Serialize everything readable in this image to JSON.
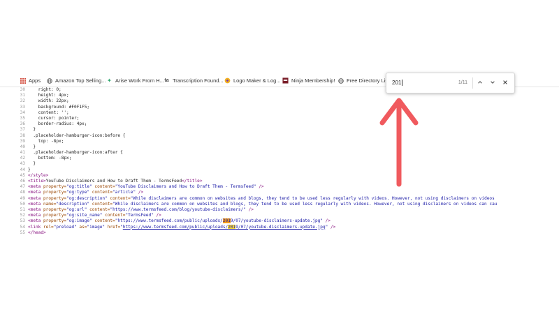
{
  "bookmarks": [
    {
      "label": "Apps",
      "icon": "apps-grid-icon"
    },
    {
      "label": "Amazon Top Selling...",
      "icon": "globe-icon"
    },
    {
      "label": "Arise Work From H...",
      "icon": "star-icon"
    },
    {
      "label": "Transcription Found...",
      "icon": "ta-icon"
    },
    {
      "label": "Logo Maker & Log...",
      "icon": "logo-maker-icon"
    },
    {
      "label": "Ninja Membership!",
      "icon": "ninja-icon"
    },
    {
      "label": "Free Directory List",
      "icon": "globe-icon"
    }
  ],
  "find": {
    "query": "201",
    "count": "1/11",
    "prev_icon": "chevron-up-icon",
    "next_icon": "chevron-down-icon",
    "close_icon": "close-icon"
  },
  "source": {
    "lines": [
      {
        "n": "30",
        "html": "    right: 0;"
      },
      {
        "n": "31",
        "html": "    height: 4px;"
      },
      {
        "n": "32",
        "html": "    width: 22px;"
      },
      {
        "n": "33",
        "html": "    background: #F0F1F5;"
      },
      {
        "n": "34",
        "html": "    content: '';"
      },
      {
        "n": "35",
        "html": "    cursor: pointer;"
      },
      {
        "n": "36",
        "html": "    border-radius: 4px;"
      },
      {
        "n": "37",
        "html": "  }"
      },
      {
        "n": "38",
        "html": "  .placeholder-hamburger-icon:before {"
      },
      {
        "n": "39",
        "html": "    top: -8px;"
      },
      {
        "n": "40",
        "html": "  }"
      },
      {
        "n": "41",
        "html": "  .placeholder-hamburger-icon:after {"
      },
      {
        "n": "42",
        "html": "    bottom: -8px;"
      },
      {
        "n": "43",
        "html": "  }"
      },
      {
        "n": "44",
        "html": "}"
      },
      {
        "n": "45",
        "html": "<span class=\"tag\">&lt;/style&gt;</span>"
      },
      {
        "n": "46",
        "html": "<span class=\"tag\">&lt;title&gt;</span>YouTube Disclaimers and How to Draft Them - TermsFeed<span class=\"tag\">&lt;/title&gt;</span>"
      },
      {
        "n": "47",
        "html": "<span class=\"tag\">&lt;meta</span> <span class=\"attr\">property=</span><span class=\"val\">\"og:title\"</span> <span class=\"attr\">content=</span><span class=\"val\">\"YouTube Disclaimers and How to Draft Them - TermsFeed\"</span> <span class=\"tag\">/&gt;</span>"
      },
      {
        "n": "48",
        "html": "<span class=\"tag\">&lt;meta</span> <span class=\"attr\">property=</span><span class=\"val\">\"og:type\"</span> <span class=\"attr\">content=</span><span class=\"val\">\"article\"</span> <span class=\"tag\">/&gt;</span>"
      },
      {
        "n": "49",
        "html": "<span class=\"tag\">&lt;meta</span> <span class=\"attr\">property=</span><span class=\"val\">\"og:description\"</span> <span class=\"attr\">content=</span><span class=\"val\">\"While disclaimers are common on websites and blogs, they tend to be used less regularly with videos. However, not using disclaimers on videos</span>"
      },
      {
        "n": "50",
        "html": "<span class=\"tag\">&lt;meta</span> <span class=\"attr\">name=</span><span class=\"val\">\"description\"</span> <span class=\"attr\">content=</span><span class=\"val\">\"While disclaimers are common on websites and blogs, they tend to be used less regularly with videos. However, not using disclaimers on videos can cau</span>"
      },
      {
        "n": "51",
        "html": "<span class=\"tag\">&lt;meta</span> <span class=\"attr\">property=</span><span class=\"val\">\"og:url\"</span> <span class=\"attr\">content=</span><span class=\"val\">\"https://www.termsfeed.com/blog/youtube-disclaimers/\"</span> <span class=\"tag\">/&gt;</span>"
      },
      {
        "n": "52",
        "html": "<span class=\"tag\">&lt;meta</span> <span class=\"attr\">property=</span><span class=\"val\">\"og:site_name\"</span> <span class=\"attr\">content=</span><span class=\"val\">\"TermsFeed\"</span> <span class=\"tag\">/&gt;</span>"
      },
      {
        "n": "53",
        "html": "<span class=\"tag\">&lt;meta</span> <span class=\"attr\">property=</span><span class=\"val\">\"og:image\"</span> <span class=\"attr\">content=</span><span class=\"val\">\"https://www.termsfeed.com/public/uploads/<span class=\"hl-cur\">201</span>9/07/youtube-disclaimers-update.jpg\"</span> <span class=\"tag\">/&gt;</span>"
      },
      {
        "n": "54",
        "html": "<span class=\"tag\">&lt;link</span> <span class=\"attr\">rel=</span><span class=\"val\">\"preload\"</span> <span class=\"attr\">as=</span><span class=\"val\">\"image\"</span> <span class=\"attr\">href=</span><span class=\"val\">\"</span><span class=\"lnk\">https://www.termsfeed.com/public/uploads/<span class=\"hl\">201</span>9/07/youtube-disclaimers-update.jpg</span><span class=\"val\">\"</span> <span class=\"tag\">/&gt;</span>"
      },
      {
        "n": "55",
        "html": "<span class=\"tag\">&lt;/head&gt;</span>"
      }
    ]
  },
  "annotation": {
    "arrow_color": "#f05a5e"
  }
}
